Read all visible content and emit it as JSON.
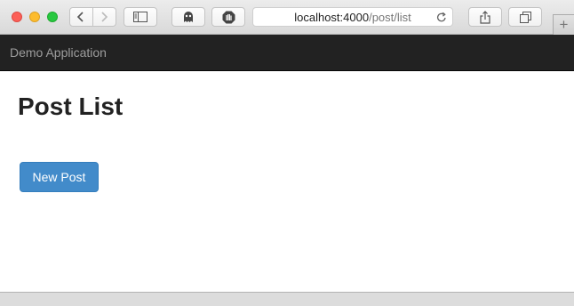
{
  "browser": {
    "address_host": "localhost:4000",
    "address_path": "/post/list",
    "new_tab_label": "+"
  },
  "navbar": {
    "brand": "Demo Application"
  },
  "main": {
    "title": "Post List",
    "new_post_label": "New Post"
  },
  "colors": {
    "navbar_bg": "#222222",
    "brand_text": "#9d9d9d",
    "primary_button": "#428bca"
  }
}
